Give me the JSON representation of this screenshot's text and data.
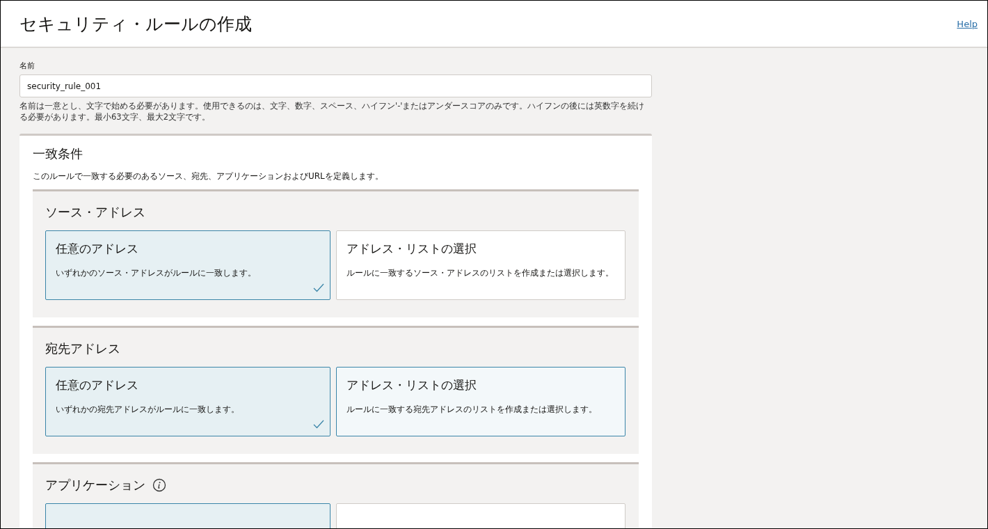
{
  "header": {
    "title": "セキュリティ・ルールの作成",
    "help_link": "Help"
  },
  "name_field": {
    "label": "名前",
    "value": "security_rule_001",
    "hint": "名前は一意とし、文字で始める必要があります。使用できるのは、文字、数字、スペース、ハイフン'-'またはアンダースコアのみです。ハイフンの後には英数字を続ける必要があります。最小63文字、最大2文字です。"
  },
  "match_conditions": {
    "title": "一致条件",
    "description": "このルールで一致する必要のあるソース、宛先、アプリケーションおよびURLを定義します。",
    "sections": [
      {
        "title": "ソース・アドレス",
        "info": false,
        "options": [
          {
            "title": "任意のアドレス",
            "description": "いずれかのソース・アドレスがルールに一致します。",
            "selected": true,
            "hovered": false
          },
          {
            "title": "アドレス・リストの選択",
            "description": "ルールに一致するソース・アドレスのリストを作成または選択します。",
            "selected": false,
            "hovered": false
          }
        ]
      },
      {
        "title": "宛先アドレス",
        "info": false,
        "options": [
          {
            "title": "任意のアドレス",
            "description": "いずれかの宛先アドレスがルールに一致します。",
            "selected": true,
            "hovered": false
          },
          {
            "title": "アドレス・リストの選択",
            "description": "ルールに一致する宛先アドレスのリストを作成または選択します。",
            "selected": false,
            "hovered": true
          }
        ]
      },
      {
        "title": "アプリケーション",
        "info": true,
        "options": [
          {
            "selected": true,
            "hovered": false
          },
          {
            "selected": false,
            "hovered": false
          }
        ]
      }
    ]
  }
}
